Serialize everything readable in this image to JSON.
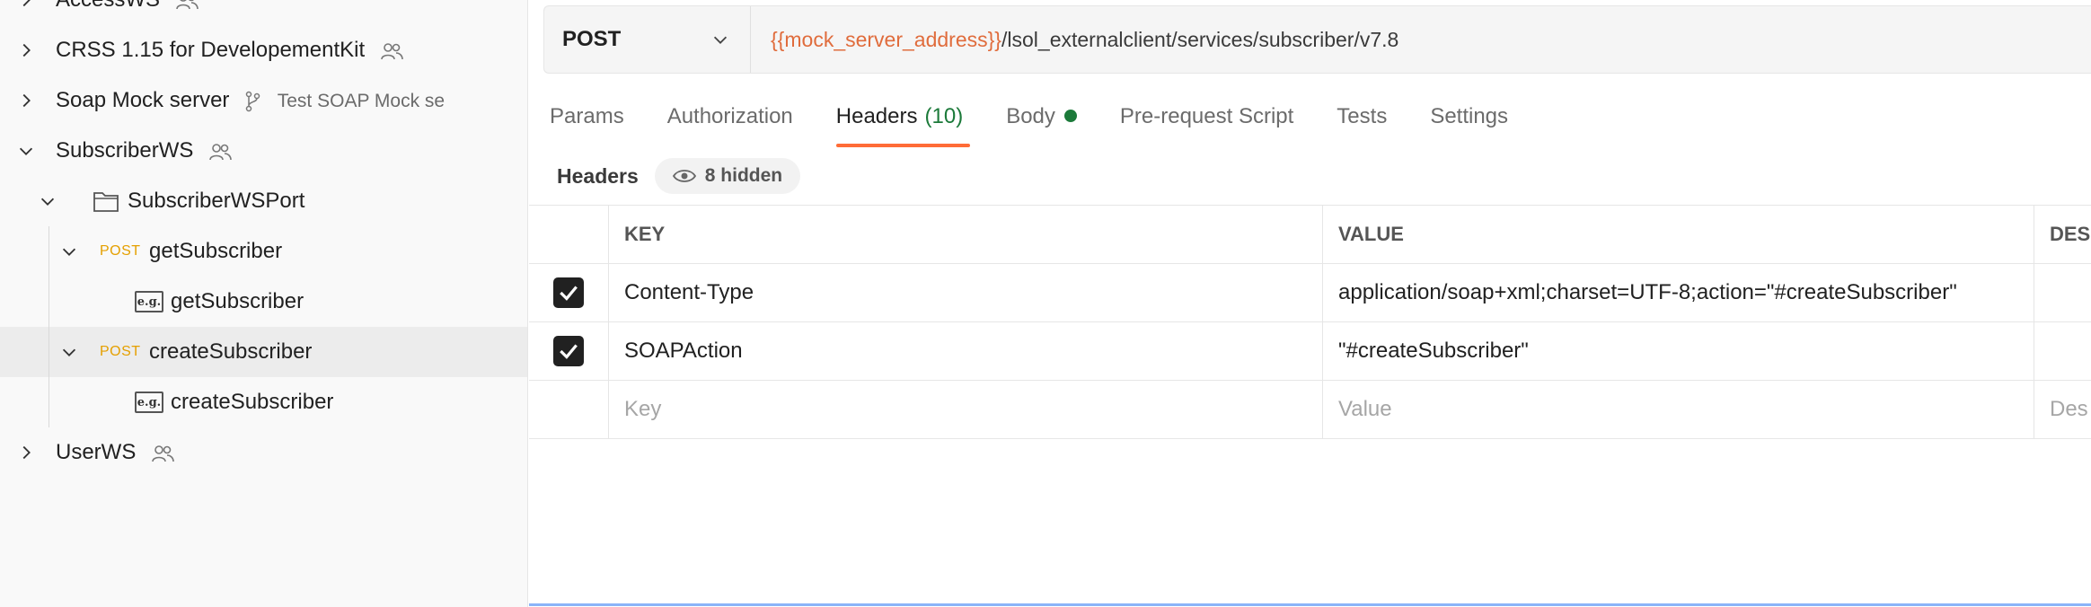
{
  "sidebar": {
    "items": [
      {
        "label": "AccessWS",
        "shared": true
      },
      {
        "label": "CRSS 1.15 for DevelopementKit",
        "shared": true
      },
      {
        "label": "Soap Mock server",
        "fork_label": "Test SOAP Mock se"
      },
      {
        "label": "SubscriberWS",
        "shared": true
      },
      {
        "label": "SubscriberWSPort"
      },
      {
        "label": "getSubscriber",
        "method": "POST"
      },
      {
        "label": "getSubscriber",
        "example": "e.g."
      },
      {
        "label": "createSubscriber",
        "method": "POST"
      },
      {
        "label": "createSubscriber",
        "example": "e.g."
      },
      {
        "label": "UserWS",
        "shared": true
      }
    ]
  },
  "request": {
    "method": "POST",
    "url_variable": "{{mock_server_address}}",
    "url_path": "/lsol_externalclient/services/subscriber/v7.8"
  },
  "tabs": [
    {
      "label": "Params"
    },
    {
      "label": "Authorization"
    },
    {
      "label": "Headers",
      "count": "(10)"
    },
    {
      "label": "Body"
    },
    {
      "label": "Pre-request Script"
    },
    {
      "label": "Tests"
    },
    {
      "label": "Settings"
    }
  ],
  "headers": {
    "title": "Headers",
    "hidden_label": "8 hidden",
    "columns": {
      "key": "KEY",
      "value": "VALUE",
      "description": "DES"
    },
    "rows": [
      {
        "key": "Content-Type",
        "value": "application/soap+xml;charset=UTF-8;action=\"#createSubscriber\""
      },
      {
        "key": "SOAPAction",
        "value": "\"#createSubscriber\""
      }
    ],
    "placeholder": {
      "key": "Key",
      "value": "Value",
      "description": "Des"
    }
  },
  "colors": {
    "accent": "#ff6c37",
    "url_variable": "#e06c3c",
    "method_post": "#e5a000",
    "count_green": "#1c7a3a"
  }
}
